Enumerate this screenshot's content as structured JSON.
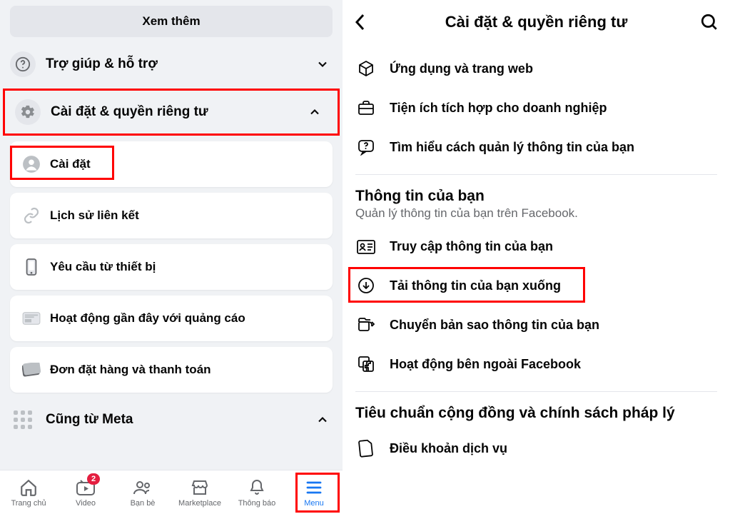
{
  "left": {
    "see_more": "Xem thêm",
    "help": "Trợ giúp & hỗ trợ",
    "settings_privacy": "Cài đặt & quyền riêng tư",
    "cards": {
      "settings": "Cài đặt",
      "link_history": "Lịch sử liên kết",
      "device_requests": "Yêu cầu từ thiết bị",
      "ad_activity": "Hoạt động gần đây với quảng cáo",
      "orders_payments": "Đơn đặt hàng và thanh toán"
    },
    "from_meta": "Cũng từ Meta",
    "nav": {
      "home": "Trang chủ",
      "video": "Video",
      "friends": "Bạn bè",
      "marketplace": "Marketplace",
      "notifications": "Thông báo",
      "menu": "Menu",
      "video_badge": "2"
    }
  },
  "right": {
    "title": "Cài đặt & quyền riêng tư",
    "items_top": {
      "apps_web": "Ứng dụng và trang web",
      "biz_integrations": "Tiện ích tích hợp cho doanh nghiệp",
      "manage_info": "Tìm hiểu cách quản lý thông tin của bạn"
    },
    "your_info_title": "Thông tin của bạn",
    "your_info_sub": "Quản lý thông tin của bạn trên Facebook.",
    "items_info": {
      "access": "Truy cập thông tin của bạn",
      "download": "Tải thông tin của bạn xuống",
      "transfer": "Chuyển bản sao thông tin của bạn",
      "off_fb": "Hoạt động bên ngoài Facebook"
    },
    "policy_title": "Tiêu chuẩn cộng đồng và chính sách pháp lý",
    "terms": "Điều khoản dịch vụ"
  }
}
